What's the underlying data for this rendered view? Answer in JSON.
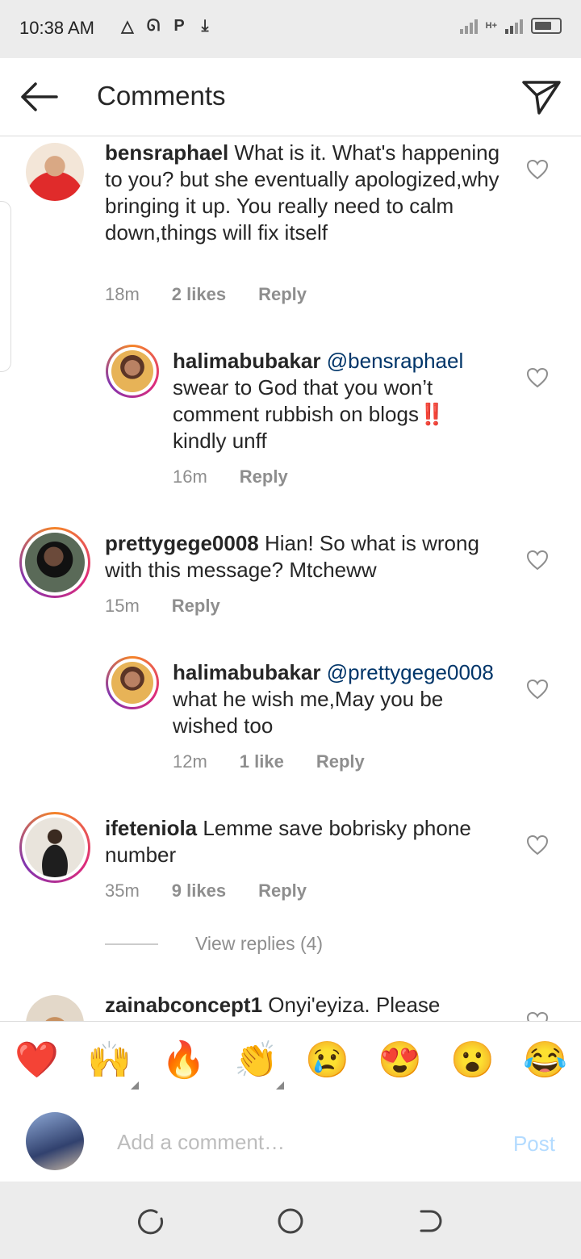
{
  "status_bar": {
    "time": "10:38 AM",
    "network": "H+"
  },
  "header": {
    "title": "Comments"
  },
  "comments": [
    {
      "username": "bensraphael",
      "text": "What is it. What's happening to you? but  she eventually apologized,why bringing it up. You really need to calm down,things will fix itself",
      "time": "18m",
      "likes": "2 likes",
      "reply": "Reply"
    },
    {
      "username": "halimabubakar",
      "mention": "@bensraphael",
      "text": "swear to God that you won’t comment rubbish on blogs‼️ kindly unff",
      "time": "16m",
      "reply": "Reply"
    },
    {
      "username": "prettygege0008",
      "text": "Hian! So what is wrong with this message? Mtcheww",
      "time": "15m",
      "reply": "Reply"
    },
    {
      "username": "halimabubakar",
      "mention": "@prettygege0008",
      "text": "what he wish me,May you be wished too",
      "time": "12m",
      "likes": "1 like",
      "reply": "Reply"
    },
    {
      "username": "ifeteniola",
      "text": "Lemme save bobrisky phone number",
      "time": "35m",
      "likes": "9 likes",
      "reply": "Reply",
      "view_replies": "View replies (4)"
    },
    {
      "username": "zainabconcept1",
      "text": "Onyi'eyiza. Please"
    }
  ],
  "emoji_bar": [
    "❤️",
    "🙌",
    "🔥",
    "👏",
    "😢",
    "😍",
    "😮",
    "😂"
  ],
  "compose": {
    "placeholder": "Add a comment…",
    "post_label": "Post"
  },
  "colors": {
    "link": "#003569",
    "meta": "#8e8e8e",
    "post": "#b3dbff"
  }
}
